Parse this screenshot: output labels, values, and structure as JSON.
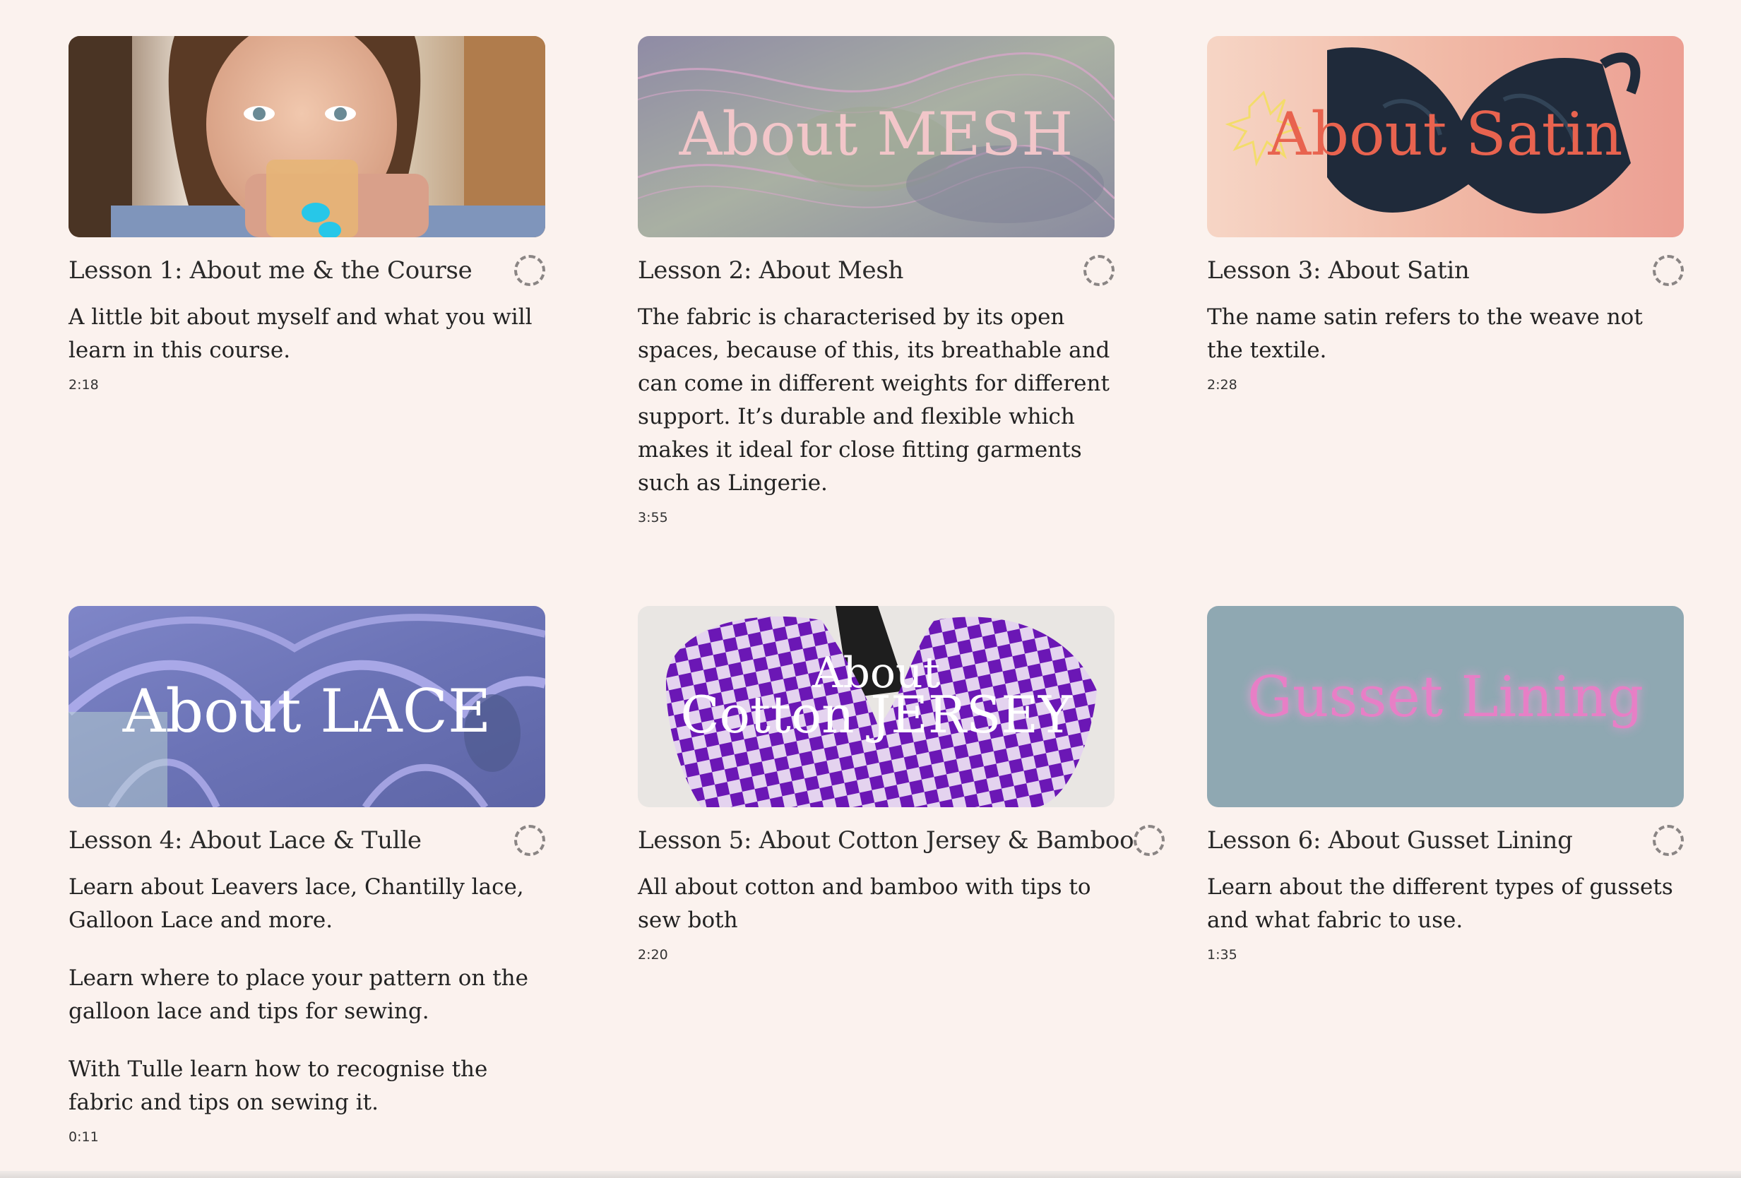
{
  "lessons": [
    {
      "thumb_title": "",
      "title": "Lesson 1: About me & the Course",
      "description": [
        "A little bit about myself and what you will learn in this course."
      ],
      "duration": "2:18"
    },
    {
      "thumb_title": "About MESH",
      "title": "Lesson 2: About Mesh",
      "description": [
        "The fabric is characterised by its open spaces, because of this, its breathable and can come in different weights for different support. It’s durable and flexible which makes it ideal for close fitting garments such as Lingerie."
      ],
      "duration": "3:55"
    },
    {
      "thumb_title": "About Satin",
      "title": "Lesson 3: About Satin",
      "description": [
        "The name satin refers to the weave not the textile."
      ],
      "duration": "2:28"
    },
    {
      "thumb_title": "About LACE",
      "title": "Lesson 4: About Lace & Tulle",
      "description": [
        "Learn about Leavers lace, Chantilly lace, Galloon Lace and more.",
        "Learn where to place your pattern on the galloon lace and tips for sewing.",
        "With Tulle learn how to recognise the fabric and tips on sewing it."
      ],
      "duration": "0:11"
    },
    {
      "thumb_title_line1": "About",
      "thumb_title_line2": "Cotton JERSEY",
      "title": "Lesson 5: About Cotton Jersey & Bamboo",
      "description": [
        "All about cotton and bamboo with tips to sew both"
      ],
      "duration": "2:20"
    },
    {
      "thumb_title": "Gusset Lining",
      "title": "Lesson 6: About Gusset Lining",
      "description": [
        "Learn about the different types of gussets and what fabric to use."
      ],
      "duration": "1:35"
    }
  ],
  "icons": {
    "status": "dashed-circle-icon"
  },
  "colors": {
    "background": "#fbf2ee",
    "status_ring": "#8a8584",
    "gusset_bg": "#8fa8b2",
    "gusset_text": "#e77fc6"
  }
}
